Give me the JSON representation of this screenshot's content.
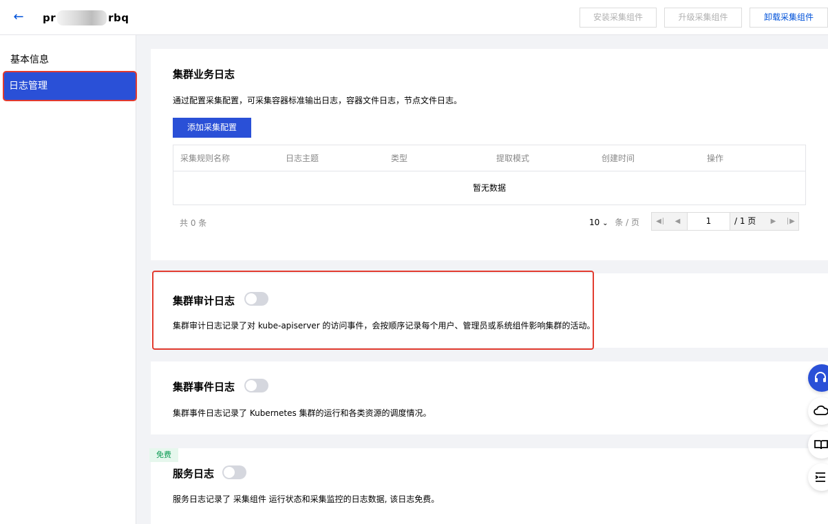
{
  "header": {
    "title_prefix": "pr",
    "title_suffix": "rbq",
    "buttons": [
      "安装采集组件",
      "升级采集组件",
      "卸载采集组件"
    ]
  },
  "sidebar": {
    "items": [
      {
        "label": "基本信息"
      },
      {
        "label": "日志管理"
      }
    ]
  },
  "business_log": {
    "title": "集群业务日志",
    "desc": "通过配置采集配置，可采集容器标准输出日志，容器文件日志，节点文件日志。",
    "add_button": "添加采集配置",
    "columns": [
      "采集规则名称",
      "日志主题",
      "类型",
      "提取模式",
      "创建时间",
      "操作"
    ],
    "empty_text": "暂无数据",
    "total": "共 0 条",
    "page_size": "10",
    "page_size_unit": "条 / 页",
    "current_page": "1",
    "total_pages": "/ 1 页"
  },
  "audit_log": {
    "title": "集群审计日志",
    "desc": "集群审计日志记录了对 kube-apiserver 的访问事件，会按顺序记录每个用户、管理员或系统组件影响集群的活动。",
    "enabled": false
  },
  "event_log": {
    "title": "集群事件日志",
    "desc": "集群事件日志记录了 Kubernetes 集群的运行和各类资源的调度情况。",
    "enabled": false
  },
  "service_log": {
    "tag": "免费",
    "title": "服务日志",
    "desc": "服务日志记录了 采集组件 运行状态和采集监控的日志数据, 该日志免费。",
    "enabled": false
  },
  "colors": {
    "primary": "#2a50d7",
    "highlight_border": "#e23a2e",
    "free_tag": "#0a9a52"
  }
}
